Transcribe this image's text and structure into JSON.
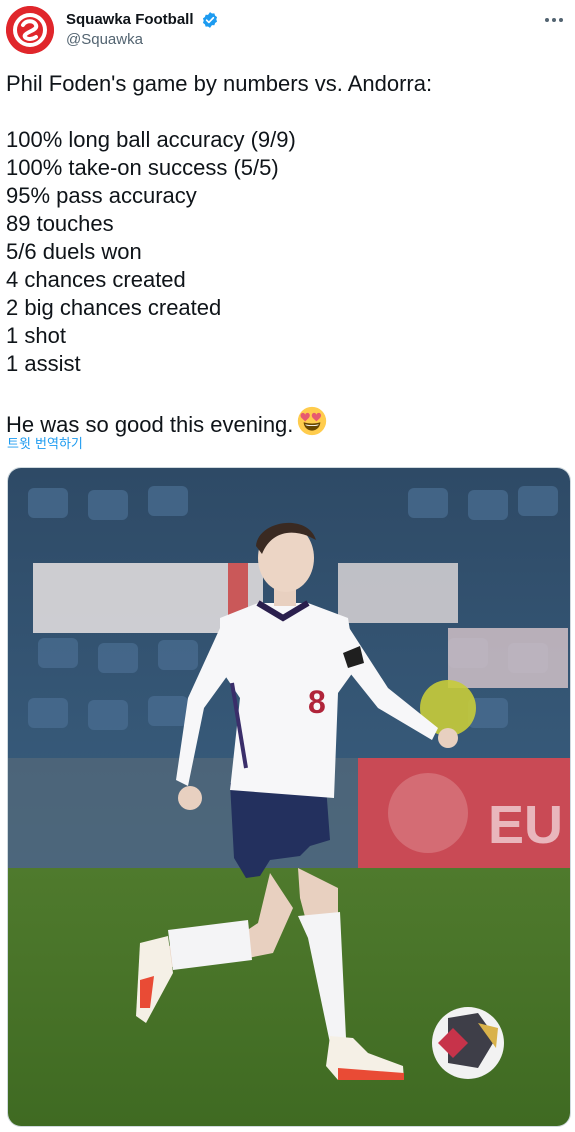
{
  "tweet": {
    "author": {
      "display_name": "Squawka Football",
      "handle": "@Squawka",
      "verified": true,
      "avatar_icon": "squawka-logo-icon"
    },
    "more_icon": "more-icon",
    "text_lines": [
      "Phil Foden's game by numbers vs. Andorra:",
      "",
      "100% long ball accuracy (9/9)",
      "100% take-on success (5/5)",
      "95% pass accuracy",
      "89 touches",
      "5/6 duels won",
      "4 chances created",
      "2 big chances created",
      "1 shot",
      "1 assist",
      "",
      "He was so good this evening."
    ],
    "emoji": "heart-eyes-emoji",
    "translate_label": "트윗 번역하기",
    "media": {
      "player_shirt_number": "8",
      "banner_text": "EU"
    }
  },
  "colors": {
    "accent": "#1d9bf0",
    "brand_red": "#e0262b",
    "text": "#0f1419",
    "muted": "#536471"
  }
}
